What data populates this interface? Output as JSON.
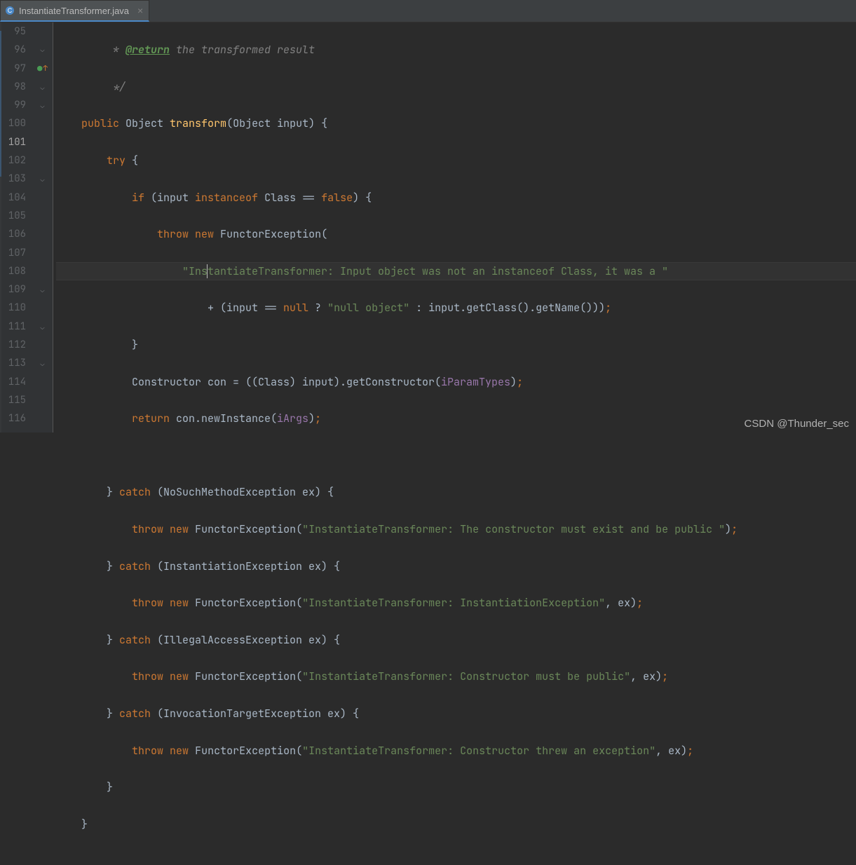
{
  "tab": {
    "filename": "InstantiateTransformer.java"
  },
  "gutter": {
    "start": 95,
    "end": 116,
    "active": 101
  },
  "watermark": "CSDN @Thunder_sec",
  "code": {
    "l95": {
      "cmt1": " * ",
      "tag": "@return",
      "cmt2": " the transformed result"
    },
    "l96": {
      "cmt": " */"
    },
    "l97": {
      "kw1": "public",
      "t1": " Object ",
      "meth": "transform",
      "t2": "(Object input) {"
    },
    "l98": {
      "kw": "try",
      "t": " {"
    },
    "l99": {
      "kw1": "if",
      "t1": " (input ",
      "kw2": "instanceof",
      "t2": " Class == ",
      "kw3": "false",
      "t3": ") {"
    },
    "l100": {
      "kw1": "throw",
      "sp": " ",
      "kw2": "new",
      "t": " FunctorException("
    },
    "l101": {
      "str_a": "\"Ins",
      "str_b": "tantiateTransformer: Input object was not an instanceof Class, it was a \""
    },
    "l102": {
      "t1": "+ (input == ",
      "kw": "null",
      "t2": " ? ",
      "str": "\"null object\"",
      "t3": " : input.getClass().getName()))",
      "semi": ";"
    },
    "l103": {
      "t": "}"
    },
    "l104": {
      "t1": "Constructor con = ((Class) input).getConstructor(",
      "fld": "iParamTypes",
      "t2": ")",
      "semi": ";"
    },
    "l105": {
      "kw": "return",
      "t1": " con.newInstance(",
      "fld": "iArgs",
      "t2": ")",
      "semi": ";"
    },
    "l106": {
      "t": ""
    },
    "l107": {
      "t1": "} ",
      "kw": "catch",
      "t2": " (NoSuchMethodException ex) {"
    },
    "l108": {
      "kw1": "throw",
      "sp": " ",
      "kw2": "new",
      "t1": " FunctorException(",
      "str": "\"InstantiateTransformer: The constructor must exist and be public \"",
      "t2": ")",
      "semi": ";"
    },
    "l109": {
      "t1": "} ",
      "kw": "catch",
      "t2": " (InstantiationException ex) {"
    },
    "l110": {
      "kw1": "throw",
      "sp": " ",
      "kw2": "new",
      "t1": " FunctorException(",
      "str": "\"InstantiateTransformer: InstantiationException\"",
      "t2": ", ex)",
      "semi": ";"
    },
    "l111": {
      "t1": "} ",
      "kw": "catch",
      "t2": " (IllegalAccessException ex) {"
    },
    "l112": {
      "kw1": "throw",
      "sp": " ",
      "kw2": "new",
      "t1": " FunctorException(",
      "str": "\"InstantiateTransformer: Constructor must be public\"",
      "t2": ", ex)",
      "semi": ";"
    },
    "l113": {
      "t1": "} ",
      "kw": "catch",
      "t2": " (InvocationTargetException ex) {"
    },
    "l114": {
      "kw1": "throw",
      "sp": " ",
      "kw2": "new",
      "t1": " FunctorException(",
      "str": "\"InstantiateTransformer: Constructor threw an exception\"",
      "t2": ", ex)",
      "semi": ";"
    },
    "l115": {
      "t": "}"
    },
    "l116": {
      "t": "}"
    }
  }
}
